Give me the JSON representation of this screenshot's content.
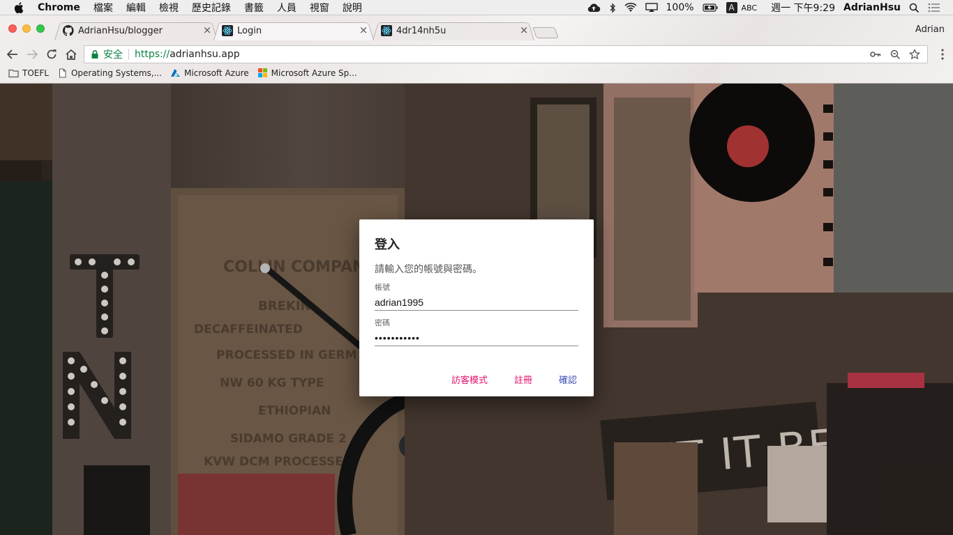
{
  "menubar": {
    "app_name": "Chrome",
    "menus": [
      "檔案",
      "編輯",
      "檢視",
      "歷史記錄",
      "書籤",
      "人員",
      "視窗",
      "說明"
    ],
    "battery": "100%",
    "input_letter": "A",
    "input_method": "ABC",
    "clock": "週一 下午9:29",
    "user": "AdrianHsu"
  },
  "browser": {
    "tabs": [
      {
        "title": "AdrianHsu/blogger",
        "favicon": "github-icon",
        "active": false
      },
      {
        "title": "Login",
        "favicon": "react-icon",
        "active": true
      },
      {
        "title": "4dr14nh5u",
        "favicon": "react-icon",
        "active": false
      }
    ],
    "profile": "Adrian",
    "omnibox": {
      "secure_label": "安全",
      "scheme": "https://",
      "host": "adrianhsu.app"
    },
    "bookmarks": [
      {
        "label": "TOEFL",
        "icon": "folder-icon"
      },
      {
        "label": "Operating Systems,...",
        "icon": "page-icon"
      },
      {
        "label": "Microsoft Azure",
        "icon": "azure-icon"
      },
      {
        "label": "Microsoft Azure Sp...",
        "icon": "microsoft-icon"
      }
    ]
  },
  "login": {
    "title": "登入",
    "description": "請輸入您的帳號與密碼。",
    "username_label": "帳號",
    "username_value": "adrian1995",
    "password_label": "密碼",
    "password_value": "•••••••••••",
    "guest_button": "訪客模式",
    "register_button": "註冊",
    "confirm_button": "確認"
  },
  "background": {
    "wall_sign": "LET IT BE",
    "marquee_letters": [
      "T",
      "N"
    ],
    "sack_lines": [
      "COLLIN COMPANY",
      "BREKIN",
      "DECAFFEINATED",
      "PROCESSED IN GERM",
      "NW 60 KG TYPE",
      "ETHIOPIAN",
      "SIDAMO GRADE 2",
      "KVW DCM PROCESSED"
    ]
  },
  "colors": {
    "accent_pink": "#e2136e",
    "accent_indigo": "#3f51b5",
    "secure_green": "#0b8043"
  }
}
